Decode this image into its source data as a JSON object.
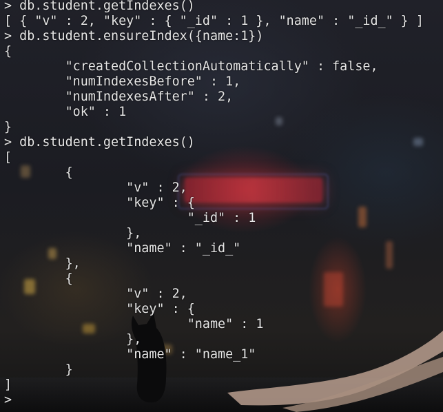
{
  "terminal": {
    "lines": [
      "> db.student.getIndexes()",
      "[ { \"v\" : 2, \"key\" : { \"_id\" : 1 }, \"name\" : \"_id_\" } ]",
      "> db.student.ensureIndex({name:1})",
      "{",
      "        \"createdCollectionAutomatically\" : false,",
      "        \"numIndexesBefore\" : 1,",
      "        \"numIndexesAfter\" : 2,",
      "        \"ok\" : 1",
      "}",
      "> db.student.getIndexes()",
      "[",
      "        {",
      "                \"v\" : 2,",
      "                \"key\" : {",
      "                        \"_id\" : 1",
      "                },",
      "                \"name\" : \"_id_\"",
      "        },",
      "        {",
      "                \"v\" : 2,",
      "                \"key\" : {",
      "                        \"name\" : 1",
      "                },",
      "                \"name\" : \"name_1\"",
      "        }",
      "]"
    ],
    "prompt": ">"
  },
  "colors": {
    "text": "#e6e6e6",
    "neon": "#d83a46"
  }
}
